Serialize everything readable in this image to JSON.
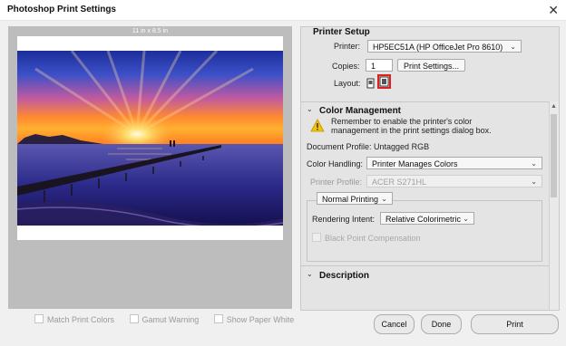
{
  "window": {
    "title": "Photoshop Print Settings",
    "close_symbol": "✕"
  },
  "preview": {
    "paper_size": "11 in x 8.5 in"
  },
  "printer_setup": {
    "heading": "Printer Setup",
    "printer_label": "Printer:",
    "printer_value": "HP5EC51A (HP OfficeJet Pro 8610)",
    "copies_label": "Copies:",
    "copies_value": "1",
    "print_settings_button": "Print Settings...",
    "layout_label": "Layout:"
  },
  "color_management": {
    "heading": "Color Management",
    "warning_line1": "Remember to enable the printer's color",
    "warning_line2": "management in the print settings dialog box.",
    "document_profile": "Document Profile: Untagged RGB",
    "color_handling_label": "Color Handling:",
    "color_handling_value": "Printer Manages Colors",
    "printer_profile_label": "Printer Profile:",
    "printer_profile_value": "ACER S271HL",
    "normal_printing": "Normal Printing",
    "rendering_intent_label": "Rendering Intent:",
    "rendering_intent_value": "Relative Colorimetric",
    "black_point_label": "Black Point Compensation"
  },
  "description": {
    "heading": "Description"
  },
  "bottom": {
    "match_print_colors": "Match Print Colors",
    "gamut_warning": "Gamut Warning",
    "show_paper_white": "Show Paper White",
    "cancel": "Cancel",
    "done": "Done",
    "print": "Print"
  },
  "colors": {
    "highlight_border": "#e02020",
    "warning_yellow": "#f5c400"
  }
}
